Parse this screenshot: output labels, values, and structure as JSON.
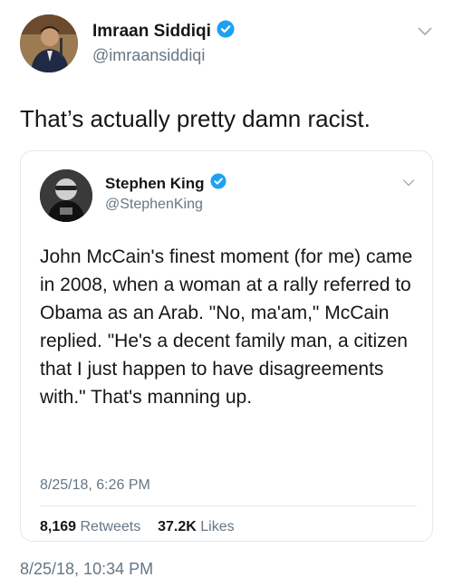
{
  "tweet": {
    "author": {
      "display_name": "Imraan Siddiqi",
      "handle": "@imraansiddiqi"
    },
    "text": "That’s actually pretty damn racist.",
    "timestamp": "8/25/18, 10:34 PM"
  },
  "quoted_tweet": {
    "author": {
      "display_name": "Stephen King",
      "handle": "@StephenKing"
    },
    "text": "John McCain's finest moment (for me) came in 2008, when a woman at a rally referred to Obama as an Arab. \"No, ma'am,\" McCain replied. \"He's a decent family man, a citizen that I just happen to have disagreements with.\" That's manning up.",
    "timestamp": "8/25/18, 6:26 PM",
    "stats": {
      "retweets_count": "8,169",
      "retweets_label": "Retweets",
      "likes_count": "37.2K",
      "likes_label": "Likes"
    }
  },
  "icons": [
    "verified-badge-icon",
    "chevron-down-icon"
  ],
  "colors": {
    "verified": "#1da1f2",
    "secondary_text": "#657786",
    "primary_text": "#14171a",
    "border": "#e1e8ed"
  }
}
